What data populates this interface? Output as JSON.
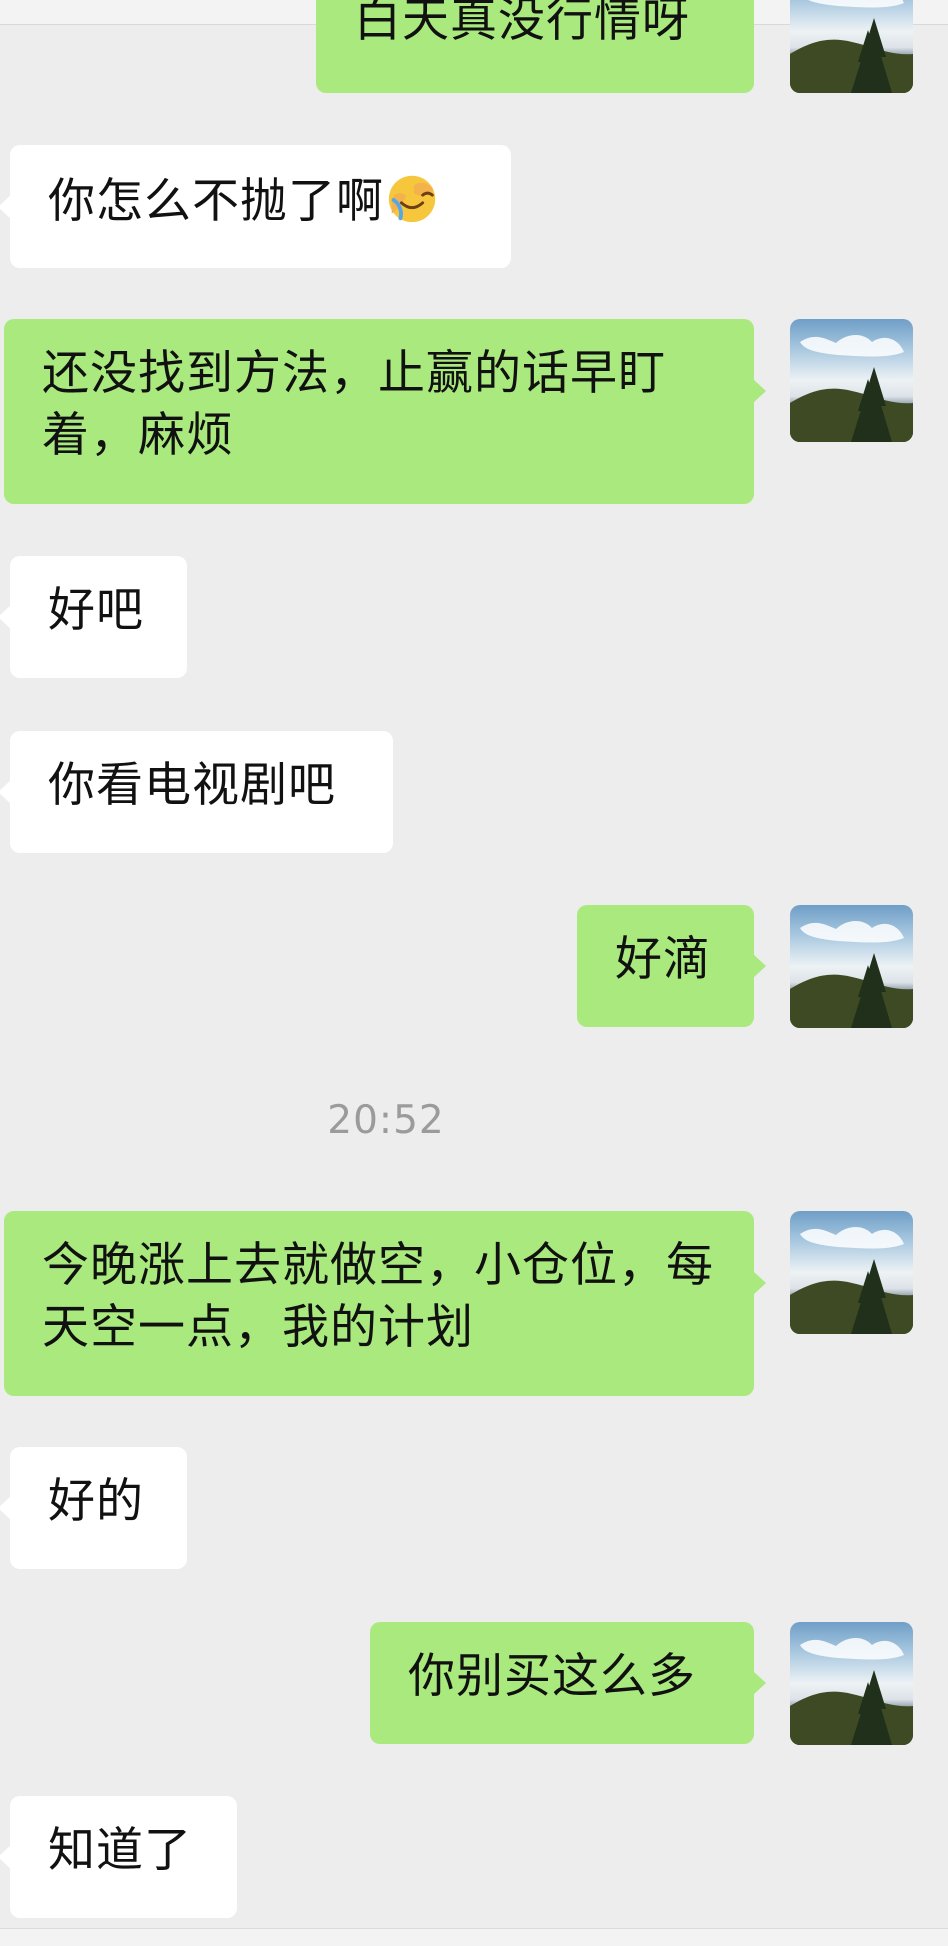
{
  "chat": {
    "timestamp": "20:52",
    "messages": [
      {
        "id": "m1",
        "side": "out",
        "text": "白天真没行情呀"
      },
      {
        "id": "m2",
        "side": "in",
        "text": "你怎么不抛了啊"
      },
      {
        "id": "m3",
        "side": "out",
        "text": "还没找到方法，止赢的话早盯着，麻烦"
      },
      {
        "id": "m4",
        "side": "in",
        "text": "好吧"
      },
      {
        "id": "m5",
        "side": "in",
        "text": "你看电视剧吧"
      },
      {
        "id": "m6",
        "side": "out",
        "text": "好滴"
      },
      {
        "id": "m7",
        "side": "out",
        "text": "今晚涨上去就做空，小仓位，每天空一点，我的计划"
      },
      {
        "id": "m8",
        "side": "in",
        "text": "好的"
      },
      {
        "id": "m9",
        "side": "out",
        "text": "你别买这么多"
      },
      {
        "id": "m10",
        "side": "in",
        "text": "知道了"
      }
    ],
    "emoji": "facepalm-emoji"
  },
  "colors": {
    "background": "#ededed",
    "incoming_bubble": "#ffffff",
    "outgoing_bubble": "#a9e97e",
    "timestamp": "#9b9b9b"
  }
}
